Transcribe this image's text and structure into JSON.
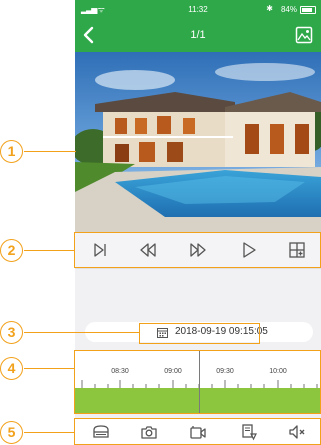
{
  "status_bar": {
    "time": "11:32",
    "battery": "84%",
    "signal_icon": "signal-wifi-icon",
    "bluetooth_icon": "bluetooth-icon",
    "battery_icon": "battery-icon"
  },
  "nav": {
    "title": "1/1",
    "back_icon": "chevron-left-icon",
    "album_icon": "image-icon"
  },
  "controls": {
    "icons": [
      "skip-next-icon",
      "rewind-icon",
      "fast-forward-icon",
      "play-icon",
      "grid-icon"
    ]
  },
  "date_selector": {
    "datetime": "2018-09-19 09:15:05",
    "icon": "calendar-icon"
  },
  "timeline": {
    "labels": [
      "08:30",
      "09:00",
      "09:30",
      "10:00"
    ]
  },
  "bottom_bar": {
    "icons": [
      "storage-icon",
      "camera-icon",
      "video-record-icon",
      "device-icon",
      "mute-icon"
    ]
  },
  "annotations": {
    "labels": [
      "1",
      "2",
      "3",
      "4",
      "5"
    ]
  },
  "colors": {
    "brand_green": "#2fa84a",
    "timeline_green": "#8cc63f",
    "callout_orange": "#f2a11b"
  }
}
